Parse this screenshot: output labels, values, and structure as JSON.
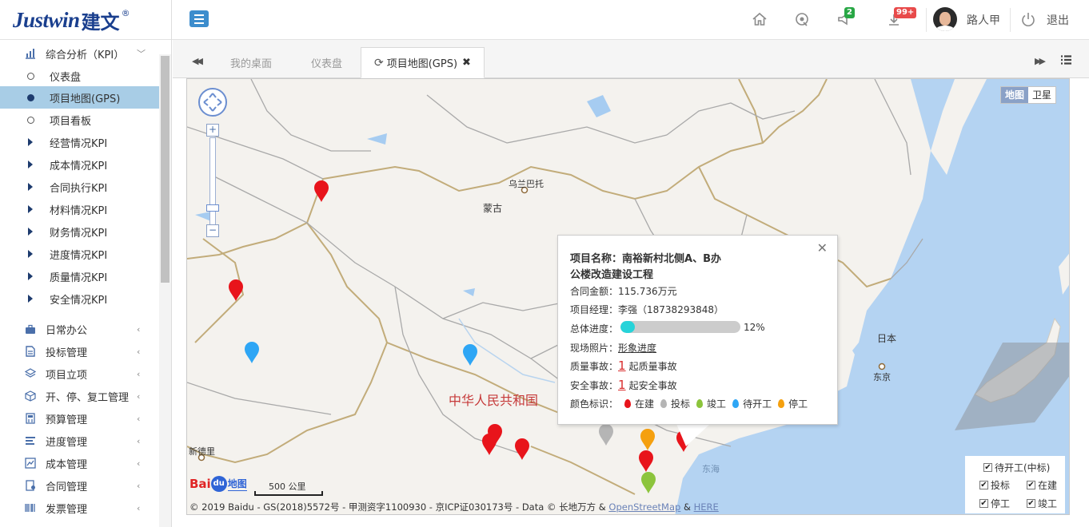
{
  "header": {
    "brand": "Justwin",
    "brand_cn": "建文",
    "brand_reg": "®",
    "notify_badge": "2",
    "message_badge": "99+",
    "username": "路人甲",
    "logout": "退出",
    "colors": {
      "brand": "#1a3f8e",
      "toggle": "#3c8dcd",
      "badge_green": "#28a745",
      "badge_red": "#e84a4a"
    }
  },
  "sidebar": {
    "kpi_group": "综合分析（KPI）",
    "kpi_items": [
      {
        "label": "仪表盘",
        "icon": "circle-icon"
      },
      {
        "label": "项目地图(GPS)",
        "icon": "dot-icon",
        "active": true
      },
      {
        "label": "项目看板",
        "icon": "circle-icon"
      },
      {
        "label": "经营情况KPI",
        "icon": "triangle-icon"
      },
      {
        "label": "成本情况KPI",
        "icon": "triangle-icon"
      },
      {
        "label": "合同执行KPI",
        "icon": "triangle-icon"
      },
      {
        "label": "材料情况KPI",
        "icon": "triangle-icon"
      },
      {
        "label": "财务情况KPI",
        "icon": "triangle-icon"
      },
      {
        "label": "进度情况KPI",
        "icon": "triangle-icon"
      },
      {
        "label": "质量情况KPI",
        "icon": "triangle-icon"
      },
      {
        "label": "安全情况KPI",
        "icon": "triangle-icon"
      }
    ],
    "groups": [
      {
        "label": "日常办公",
        "icon": "briefcase-icon"
      },
      {
        "label": "投标管理",
        "icon": "document-icon"
      },
      {
        "label": "项目立项",
        "icon": "layers-icon"
      },
      {
        "label": "开、停、复工管理",
        "icon": "cube-icon"
      },
      {
        "label": "预算管理",
        "icon": "calculator-icon"
      },
      {
        "label": "进度管理",
        "icon": "list-icon"
      },
      {
        "label": "成本管理",
        "icon": "chart-icon"
      },
      {
        "label": "合同管理",
        "icon": "contract-icon"
      },
      {
        "label": "发票管理",
        "icon": "barcode-icon"
      }
    ]
  },
  "tabs": [
    {
      "label": "我的桌面"
    },
    {
      "label": "仪表盘"
    },
    {
      "label": "项目地图(GPS)",
      "active": true
    }
  ],
  "map": {
    "type_buttons": [
      "地图",
      "卫星"
    ],
    "labels": {
      "ulaanbaatar": "乌兰巴托",
      "mongolia": "蒙古",
      "china": "中华人民共和国",
      "japan": "日本",
      "tokyo": "东京",
      "east_sea": "东海",
      "new_delhi": "新德里"
    },
    "scale": "500 公里",
    "baidu_logo_a": "Bai",
    "baidu_logo_b": "du",
    "baidu_logo_c": "地图",
    "attribution": "© 2019 Baidu - GS(2018)5572号 - 甲测资字1100930 - 京ICP证030173号 - Data © 长地万方 &",
    "attribution_link1": "OpenStreetMap",
    "attribution_amp": "&",
    "attribution_link2": "HERE"
  },
  "popup": {
    "name_label": "项目名称：",
    "name_line1": "南裕新村北侧A、B办",
    "name_line2": "公楼改造建设工程",
    "contract_label": "合同金额：",
    "contract_value": "115.736万元",
    "manager_label": "项目经理：",
    "manager_value": "李强（18738293848）",
    "progress_label": "总体进度：",
    "progress_value": 0.12,
    "progress_text": "12%",
    "photo_label": "现场照片：",
    "photo_link": "形象进度",
    "quality_label": "质量事故：",
    "quality_count": "1",
    "quality_unit": "起质量事故",
    "safety_label": "安全事故：",
    "safety_count": "1",
    "safety_unit": "起安全事故",
    "legend_label": "颜色标识：",
    "legend": [
      {
        "label": "在建",
        "color": "#e8141b"
      },
      {
        "label": "投标",
        "color": "#b5b5b5"
      },
      {
        "label": "竣工",
        "color": "#8cc43c"
      },
      {
        "label": "待开工",
        "color": "#2ea6f5"
      },
      {
        "label": "停工",
        "color": "#f5a00f"
      }
    ]
  },
  "filters": {
    "pending_bid": "待开工(中标)",
    "bidding": "投标",
    "building": "在建",
    "stopped": "停工",
    "finished": "竣工"
  }
}
